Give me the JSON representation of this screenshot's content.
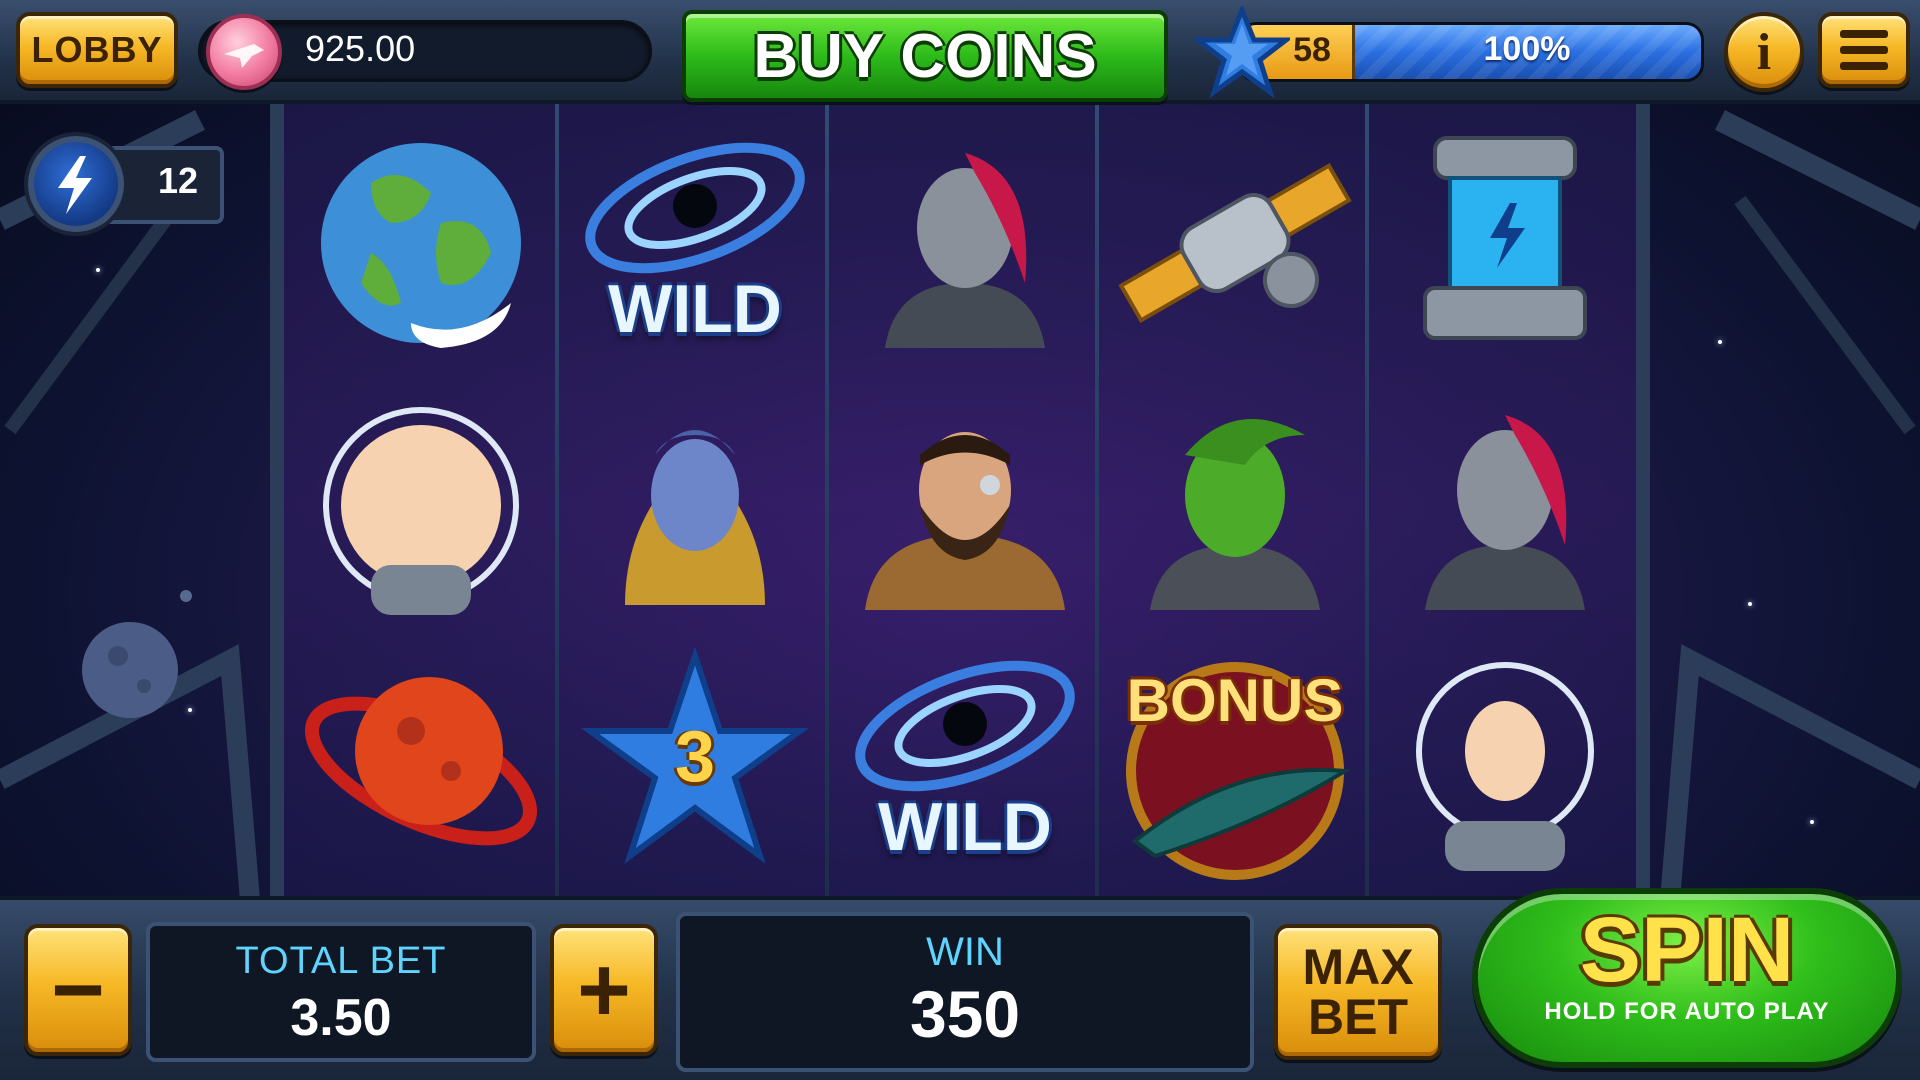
{
  "header": {
    "lobby_label": "LOBBY",
    "balance": "925.00",
    "buy_coins_label": "BUY COINS",
    "level": "58",
    "xp_percent_label": "100%",
    "xp_fraction": 1.0,
    "info_label": "i"
  },
  "power_counter": {
    "value": "12"
  },
  "reels": [
    [
      "earth",
      "wild",
      "red-planet"
    ],
    [
      "wild",
      "blue-alien-woman",
      "star-3"
    ],
    [
      "cyborg-woman",
      "bearded-cyborg",
      "wild"
    ],
    [
      "satellite",
      "green-alien",
      "bonus"
    ],
    [
      "energy-cell",
      "cyborg-woman",
      "astronaut-woman"
    ]
  ],
  "reel_texts": {
    "wild": "WILD",
    "bonus": "BONUS",
    "star_3": "3"
  },
  "footer": {
    "minus_label": "−",
    "total_bet_label": "TOTAL BET",
    "total_bet_value": "3.50",
    "plus_label": "+",
    "win_label": "WIN",
    "win_value": "350",
    "max_bet_line1": "MAX",
    "max_bet_line2": "BET",
    "spin_label": "SPIN",
    "spin_sub": "HOLD FOR AUTO PLAY"
  },
  "colors": {
    "gold": "#f6b826",
    "green": "#2dbb1a",
    "accent_blue": "#5fd4ff",
    "xp_blue": "#2a6fe0"
  }
}
